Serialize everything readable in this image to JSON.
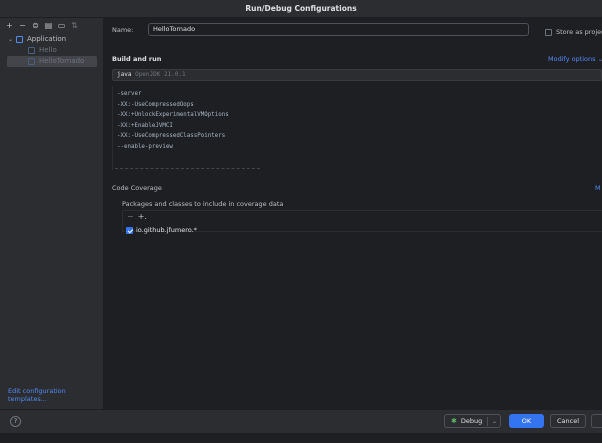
{
  "window": {
    "title": "Run/Debug Configurations"
  },
  "toolbar": {
    "icons": [
      "add-icon",
      "remove-icon",
      "copy-icon",
      "save-icon",
      "folder-icon",
      "sort-icon"
    ]
  },
  "tree": {
    "root": "Application",
    "children": [
      "Hello",
      "HelloTornado"
    ],
    "selected": "HelloTornado"
  },
  "edit_templates": "Edit configuration templates...",
  "form": {
    "name_label": "Name:",
    "name_value": "HelloTornado",
    "store_label": "Store as project file",
    "build_run": "Build and run",
    "modify_options": "Modify options",
    "jre_kw": "java",
    "jre_sub": "OpenJDK 21.0.1",
    "vm_options": [
      "-server",
      "-XX:-UseCompressedOops",
      "-XX:+UnlockExperimentalVMOptions",
      "-XX:+EnableJVMCI",
      "-XX:-UseCompressedClassPointers",
      "--enable-preview"
    ],
    "code_coverage": "Code Coverage",
    "coverage_more": "M",
    "pkg_label": "Packages and classes to include in coverage data",
    "pkg_item": "io.github.jfumero.*"
  },
  "buttons": {
    "help": "?",
    "debug": "Debug",
    "ok": "OK",
    "cancel": "Cancel"
  }
}
